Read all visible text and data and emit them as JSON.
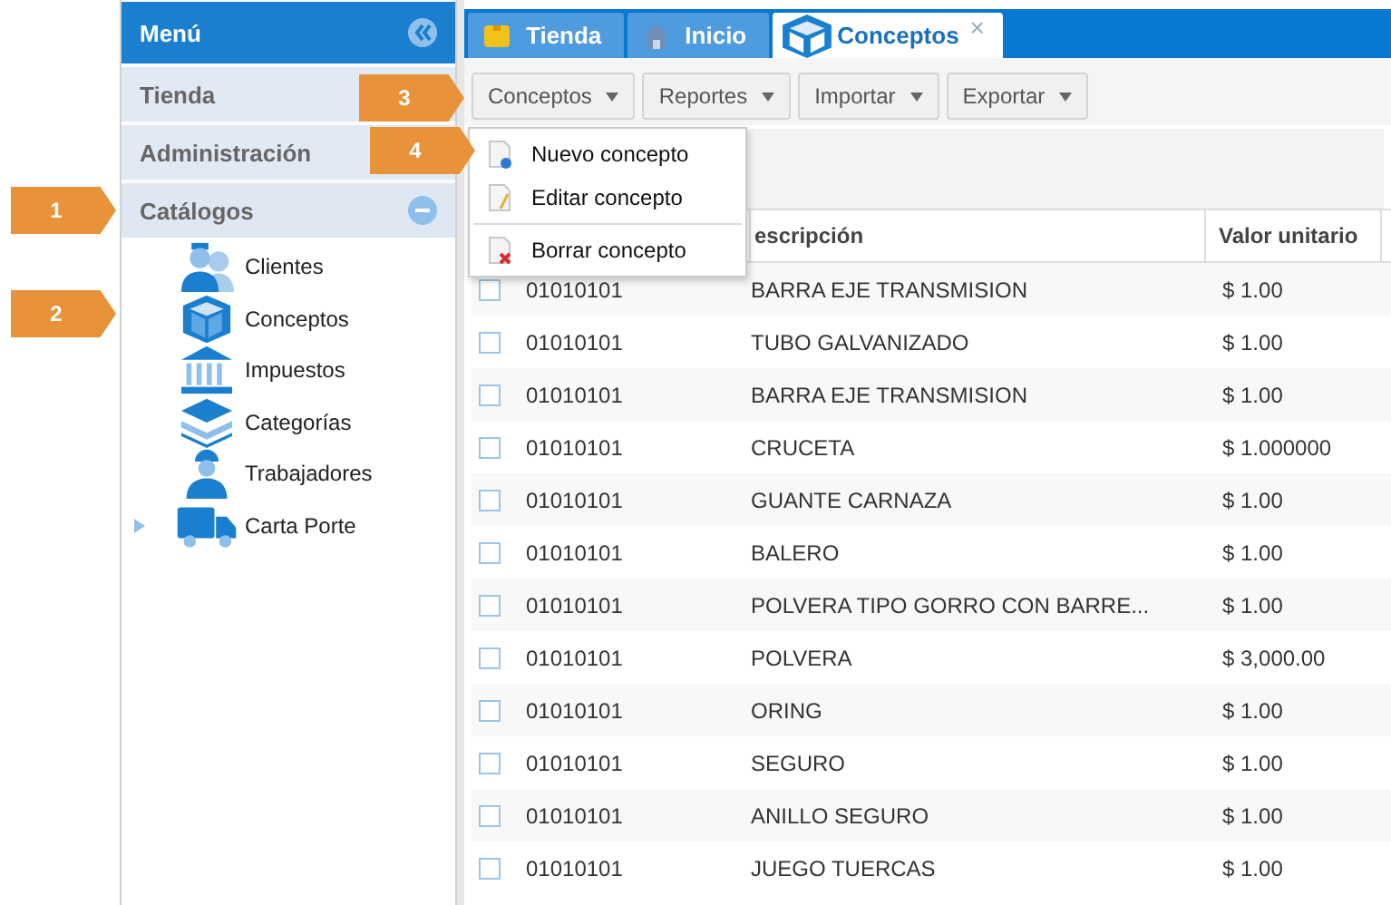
{
  "sidebar": {
    "title": "Menú",
    "sections": [
      {
        "label": "Tienda"
      },
      {
        "label": "Administración"
      },
      {
        "label": "Catálogos",
        "expanded": true,
        "children": [
          {
            "label": "Clientes",
            "kind": "clients",
            "expandable": false
          },
          {
            "label": "Conceptos",
            "kind": "box",
            "expandable": false
          },
          {
            "label": "Impuestos",
            "kind": "bank",
            "expandable": false
          },
          {
            "label": "Categorías",
            "kind": "layers",
            "expandable": false
          },
          {
            "label": "Trabajadores",
            "kind": "worker",
            "expandable": false
          },
          {
            "label": "Carta Porte",
            "kind": "truck",
            "expandable": true
          }
        ]
      }
    ]
  },
  "tabs": [
    {
      "label": "Tienda",
      "kind": "note",
      "selected": false
    },
    {
      "label": "Inicio",
      "kind": "home",
      "selected": false
    },
    {
      "label": "Conceptos",
      "kind": "box",
      "selected": true,
      "close": "×"
    }
  ],
  "toolbar": [
    "Conceptos",
    "Reportes",
    "Importar",
    "Exportar"
  ],
  "menu": [
    {
      "label": "Nuevo concepto",
      "kind": "new"
    },
    {
      "label": "Editar concepto",
      "kind": "edit"
    },
    {
      "label": "Borrar concepto",
      "kind": "delete"
    }
  ],
  "table": {
    "columns": [
      "escripción",
      "Valor unitario"
    ],
    "rows": [
      {
        "checked": false,
        "code": "01010101",
        "description": "BARRA EJE TRANSMISION",
        "price": "$ 1.00"
      },
      {
        "checked": false,
        "code": "01010101",
        "description": "TUBO GALVANIZADO",
        "price": "$ 1.00"
      },
      {
        "checked": false,
        "code": "01010101",
        "description": "BARRA EJE TRANSMISION",
        "price": "$ 1.00"
      },
      {
        "checked": false,
        "code": "01010101",
        "description": "CRUCETA",
        "price": "$ 1.000000"
      },
      {
        "checked": false,
        "code": "01010101",
        "description": "GUANTE CARNAZA",
        "price": "$ 1.00"
      },
      {
        "checked": false,
        "code": "01010101",
        "description": "BALERO",
        "price": "$ 1.00"
      },
      {
        "checked": false,
        "code": "01010101",
        "description": "POLVERA TIPO GORRO CON BARRE...",
        "price": "$ 1.00"
      },
      {
        "checked": false,
        "code": "01010101",
        "description": "POLVERA",
        "price": "$ 3,000.00"
      },
      {
        "checked": false,
        "code": "01010101",
        "description": "ORING",
        "price": "$ 1.00"
      },
      {
        "checked": false,
        "code": "01010101",
        "description": "SEGURO",
        "price": "$ 1.00"
      },
      {
        "checked": false,
        "code": "01010101",
        "description": "ANILLO SEGURO",
        "price": "$ 1.00"
      },
      {
        "checked": false,
        "code": "01010101",
        "description": "JUEGO TUERCAS",
        "price": "$ 1.00"
      }
    ]
  },
  "callouts": [
    "1",
    "2",
    "3",
    "4"
  ]
}
